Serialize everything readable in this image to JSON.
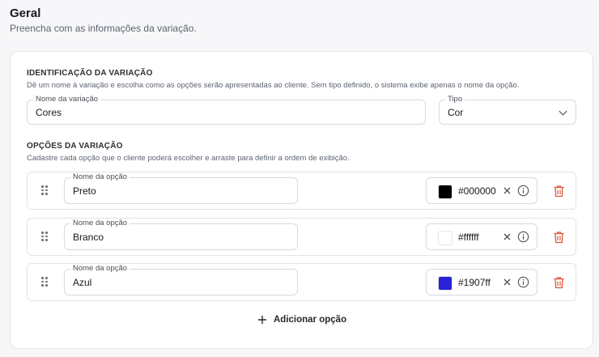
{
  "header": {
    "title": "Geral",
    "subtitle": "Preencha com as informações da variação."
  },
  "identification": {
    "title": "IDENTIFICAÇÃO DA VARIAÇÃO",
    "description": "Dê um nome à variação e escolha como as opções serão apresentadas ao cliente. Sem tipo definido, o sistema exibe apenas o nome da opção.",
    "name_label": "Nome da variação",
    "name_value": "Cores",
    "type_label": "Tipo",
    "type_value": "Cor"
  },
  "options": {
    "title": "OPÇÕES DA VARIAÇÃO",
    "description": "Cadastre cada opção que o cliente poderá escolher e arraste para definir a ordem de exibição.",
    "option_label": "Nome da opção",
    "items": [
      {
        "name": "Preto",
        "hex": "#000000",
        "color": "#000000"
      },
      {
        "name": "Branco",
        "hex": "#ffffff",
        "color": "#ffffff"
      },
      {
        "name": "Azul",
        "hex": "#1907ff",
        "color": "#2a22d6"
      }
    ],
    "add_label": "Adicionar opção"
  },
  "colors": {
    "danger": "#e0553a",
    "border": "#d6d9de"
  },
  "icons": {
    "drag": "drag-handle-icon",
    "clear": "close-icon",
    "info": "info-icon",
    "delete": "trash-icon",
    "add": "plus-icon",
    "select": "chevron-down-icon"
  }
}
